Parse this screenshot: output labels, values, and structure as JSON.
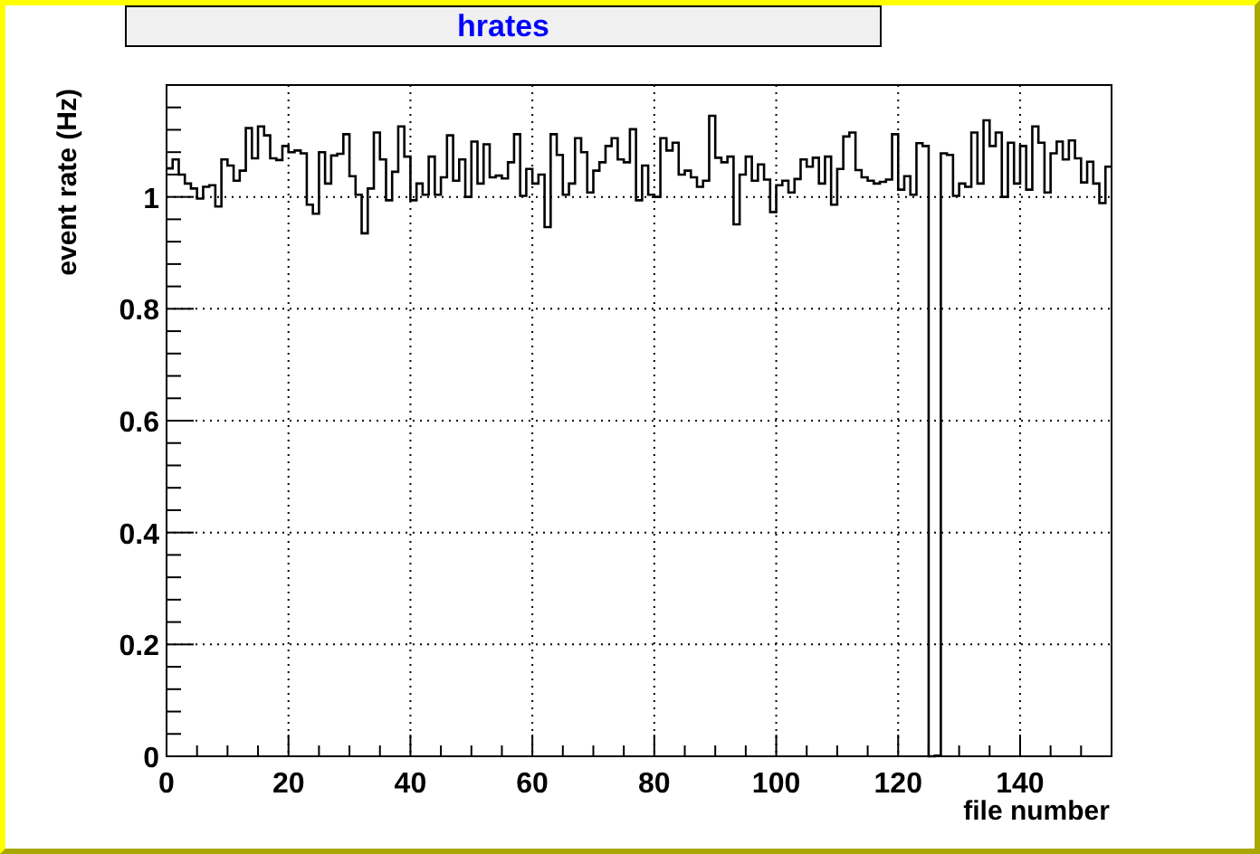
{
  "chart_data": {
    "type": "line",
    "title": "hrates",
    "xlabel": "file number",
    "ylabel": "event rate (Hz)",
    "xlim": [
      0,
      155
    ],
    "ylim": [
      0,
      1.2
    ],
    "xticks": [
      0,
      20,
      40,
      60,
      80,
      100,
      120,
      140
    ],
    "yticks": [
      0,
      0.2,
      0.4,
      0.6,
      0.8,
      1
    ],
    "grid": true,
    "x": [
      0,
      1,
      1,
      2,
      2,
      3,
      3,
      4,
      4,
      5,
      5,
      6,
      6,
      7,
      7,
      8,
      8,
      9,
      9,
      10,
      10,
      11,
      11,
      12,
      12,
      13,
      13,
      14,
      14,
      15,
      15,
      16,
      16,
      17,
      17,
      18,
      18,
      19,
      19,
      20,
      20,
      21,
      21,
      22,
      22,
      23,
      23,
      24,
      24,
      25,
      25,
      26,
      26,
      27,
      27,
      28,
      28,
      29,
      29,
      30,
      30,
      31,
      31,
      32,
      32,
      33,
      33,
      34,
      34,
      35,
      35,
      36,
      36,
      37,
      37,
      38,
      38,
      39,
      39,
      40,
      40,
      41,
      41,
      42,
      42,
      43,
      43,
      44,
      44,
      45,
      45,
      46,
      46,
      47,
      47,
      48,
      48,
      49,
      49,
      50,
      50,
      51,
      51,
      52,
      52,
      53,
      53,
      54,
      54,
      55,
      55,
      56,
      56,
      57,
      57,
      58,
      58,
      59,
      59,
      60,
      60,
      61,
      61,
      62,
      62,
      63,
      63,
      64,
      64,
      65,
      65,
      66,
      66,
      67,
      67,
      68,
      68,
      69,
      69,
      70,
      70,
      71,
      71,
      72,
      72,
      73,
      73,
      74,
      74,
      75,
      75,
      76,
      76,
      77,
      77,
      78,
      78,
      79,
      79,
      80,
      80,
      81,
      81,
      82,
      82,
      83,
      83,
      84,
      84,
      85,
      85,
      86,
      86,
      87,
      87,
      88,
      88,
      89,
      89,
      90,
      90,
      91,
      91,
      92,
      92,
      93,
      93,
      94,
      94,
      95,
      95,
      96,
      96,
      97,
      97,
      98,
      98,
      99,
      99,
      100,
      100,
      101,
      101,
      102,
      102,
      103,
      103,
      104,
      104,
      105,
      105,
      106,
      106,
      107,
      107,
      108,
      108,
      109,
      109,
      110,
      110,
      111,
      111,
      112,
      112,
      113,
      113,
      114,
      114,
      115,
      115,
      116,
      116,
      117,
      117,
      118,
      118,
      119,
      119,
      120,
      120,
      121,
      121,
      122,
      122,
      123,
      123,
      124,
      124,
      125,
      125,
      126,
      126,
      127,
      127,
      128,
      128,
      129,
      129,
      130,
      130,
      131,
      131,
      132,
      132,
      133,
      133,
      134,
      134,
      135,
      135,
      136,
      136,
      137,
      137,
      138,
      138,
      139,
      139,
      140,
      140,
      141,
      141,
      142,
      142,
      143,
      143,
      144,
      144,
      145,
      145,
      146,
      146,
      147,
      147,
      148,
      148,
      149,
      149,
      150,
      150,
      151,
      151,
      152,
      152,
      153,
      153,
      154,
      154,
      155
    ],
    "series": [
      {
        "color": "#000000",
        "values": [
          1.051,
          1.051,
          1.067,
          1.067,
          1.04,
          1.04,
          1.024,
          1.024,
          1.015,
          1.015,
          0.997,
          0.997,
          1.018,
          1.018,
          1.021,
          1.021,
          0.983,
          0.983,
          1.067,
          1.067,
          1.056,
          1.056,
          1.029,
          1.029,
          1.047,
          1.047,
          1.123,
          1.123,
          1.069,
          1.069,
          1.126,
          1.126,
          1.11,
          1.11,
          1.069,
          1.069,
          1.066,
          1.066,
          1.091,
          1.091,
          1.08,
          1.08,
          1.083,
          1.083,
          1.078,
          1.078,
          0.986,
          0.986,
          0.97,
          0.97,
          1.08,
          1.08,
          1.024,
          1.024,
          1.074,
          1.074,
          1.077,
          1.077,
          1.112,
          1.112,
          1.037,
          1.037,
          1.004,
          1.004,
          0.935,
          0.935,
          1.015,
          1.015,
          1.115,
          1.115,
          1.067,
          1.067,
          0.994,
          0.994,
          1.045,
          1.045,
          1.126,
          1.126,
          1.072,
          1.072,
          0.994,
          0.994,
          1.024,
          1.024,
          1.004,
          1.004,
          1.072,
          1.072,
          1.004,
          1.004,
          1.035,
          1.035,
          1.11,
          1.11,
          1.029,
          1.029,
          1.067,
          1.067,
          1.0,
          1.0,
          1.099,
          1.099,
          1.024,
          1.024,
          1.094,
          1.094,
          1.035,
          1.035,
          1.038,
          1.038,
          1.033,
          1.033,
          1.062,
          1.062,
          1.112,
          1.112,
          1.002,
          1.002,
          1.05,
          1.05,
          1.024,
          1.024,
          1.04,
          1.04,
          0.946,
          0.946,
          1.112,
          1.112,
          1.075,
          1.075,
          1.004,
          1.004,
          1.024,
          1.024,
          1.105,
          1.105,
          1.08,
          1.08,
          1.008,
          1.008,
          1.047,
          1.047,
          1.062,
          1.062,
          1.091,
          1.091,
          1.105,
          1.105,
          1.067,
          1.067,
          1.062,
          1.062,
          1.121,
          1.121,
          0.994,
          0.994,
          1.056,
          1.056,
          1.004,
          1.004,
          1.0,
          1.0,
          1.105,
          1.105,
          1.083,
          1.083,
          1.097,
          1.097,
          1.04,
          1.04,
          1.047,
          1.047,
          1.035,
          1.035,
          1.018,
          1.018,
          1.029,
          1.029,
          1.145,
          1.145,
          1.07,
          1.07,
          1.062,
          1.062,
          1.072,
          1.072,
          0.951,
          0.951,
          1.04,
          1.04,
          1.072,
          1.072,
          1.029,
          1.029,
          1.058,
          1.058,
          1.031,
          1.031,
          0.973,
          0.973,
          1.021,
          1.021,
          1.029,
          1.029,
          1.008,
          1.008,
          1.032,
          1.032,
          1.067,
          1.067,
          1.054,
          1.054,
          1.07,
          1.07,
          1.024,
          1.024,
          1.072,
          1.072,
          0.986,
          0.986,
          1.05,
          1.05,
          1.108,
          1.108,
          1.115,
          1.115,
          1.048,
          1.048,
          1.035,
          1.035,
          1.029,
          1.029,
          1.024,
          1.024,
          1.027,
          1.027,
          1.031,
          1.031,
          1.112,
          1.112,
          1.013,
          1.013,
          1.037,
          1.037,
          1.004,
          1.004,
          1.096,
          1.096,
          1.091,
          1.091,
          0,
          0,
          0.001,
          0.001,
          1.078,
          1.078,
          1.075,
          1.075,
          1.002,
          1.002,
          1.024,
          1.024,
          1.018,
          1.018,
          1.115,
          1.115,
          1.024,
          1.024,
          1.137,
          1.137,
          1.091,
          1.091,
          1.115,
          1.115,
          1.0,
          1.0,
          1.097,
          1.097,
          1.024,
          1.024,
          1.091,
          1.091,
          1.013,
          1.013,
          1.126,
          1.126,
          1.097,
          1.097,
          1.008,
          1.008,
          1.078,
          1.078,
          1.099,
          1.099,
          1.067,
          1.067,
          1.101,
          1.101,
          1.069,
          1.069,
          1.026,
          1.026,
          1.063,
          1.063,
          1.024,
          1.024,
          0.989,
          0.989,
          1.054,
          1.054
        ]
      }
    ]
  }
}
